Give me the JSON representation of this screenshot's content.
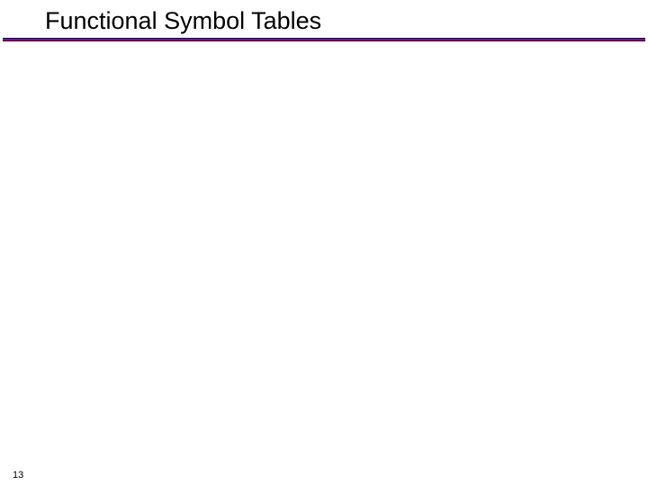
{
  "slide": {
    "title": "Functional Symbol Tables",
    "page_number": "13"
  }
}
